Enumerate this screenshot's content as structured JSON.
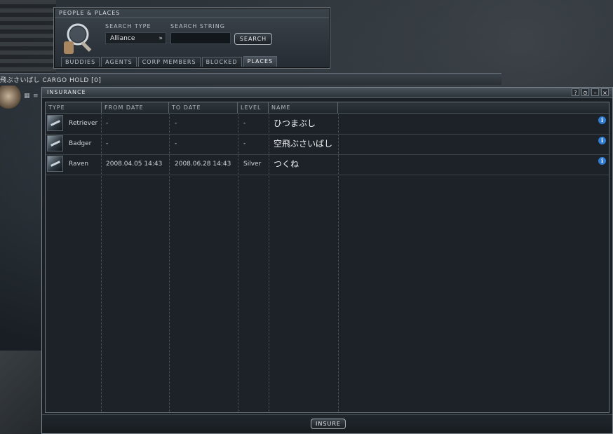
{
  "people_places": {
    "title": "PEOPLE & PLACES",
    "search_type_label": "SEARCH TYPE",
    "search_type_value": "Alliance",
    "search_string_label": "SEARCH STRING",
    "search_string_value": "",
    "search_button": "SEARCH",
    "tabs": [
      {
        "label": "BUDDIES"
      },
      {
        "label": "AGENTS"
      },
      {
        "label": "CORP MEMBERS"
      },
      {
        "label": "BLOCKED"
      },
      {
        "label": "PLACES",
        "active": true
      }
    ]
  },
  "cargo": {
    "label": "飛ぶさいばし CARGO HOLD [0]"
  },
  "insurance": {
    "title": "INSURANCE",
    "window_buttons": [
      "?",
      "⊙",
      "–",
      "×"
    ],
    "columns": [
      "TYPE",
      "FROM DATE",
      "TO DATE",
      "LEVEL",
      "NAME"
    ],
    "rows": [
      {
        "type": "Retriever",
        "from": "-",
        "to": "-",
        "level": "-",
        "name": "ひつまぶし"
      },
      {
        "type": "Badger",
        "from": "-",
        "to": "-",
        "level": "-",
        "name": "空飛ぶさいばし"
      },
      {
        "type": "Raven",
        "from": "2008.04.05 14:43",
        "to": "2008.06.28 14:43",
        "level": "Silver",
        "name": "つくね"
      }
    ],
    "insure_button": "INSURE"
  },
  "icons": {
    "magnifier": "magnifier-icon",
    "info": "info-icon",
    "chevron": "double-chevron-down-icon"
  },
  "colors": {
    "accent_info": "#2f7dd4",
    "window_bg": "#1a2025"
  }
}
